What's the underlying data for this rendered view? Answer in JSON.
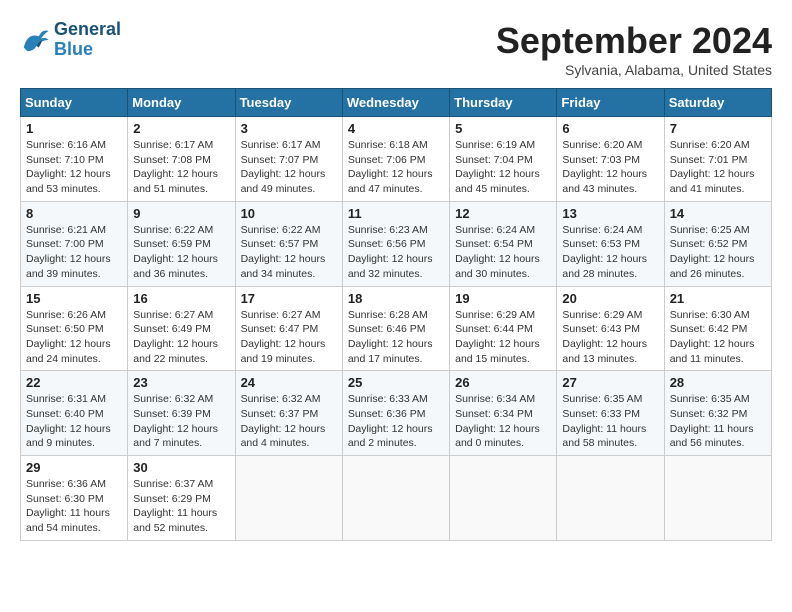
{
  "header": {
    "logo_line1": "General",
    "logo_line2": "Blue",
    "month": "September 2024",
    "location": "Sylvania, Alabama, United States"
  },
  "weekdays": [
    "Sunday",
    "Monday",
    "Tuesday",
    "Wednesday",
    "Thursday",
    "Friday",
    "Saturday"
  ],
  "weeks": [
    [
      {
        "day": "1",
        "info": "Sunrise: 6:16 AM\nSunset: 7:10 PM\nDaylight: 12 hours\nand 53 minutes."
      },
      {
        "day": "2",
        "info": "Sunrise: 6:17 AM\nSunset: 7:08 PM\nDaylight: 12 hours\nand 51 minutes."
      },
      {
        "day": "3",
        "info": "Sunrise: 6:17 AM\nSunset: 7:07 PM\nDaylight: 12 hours\nand 49 minutes."
      },
      {
        "day": "4",
        "info": "Sunrise: 6:18 AM\nSunset: 7:06 PM\nDaylight: 12 hours\nand 47 minutes."
      },
      {
        "day": "5",
        "info": "Sunrise: 6:19 AM\nSunset: 7:04 PM\nDaylight: 12 hours\nand 45 minutes."
      },
      {
        "day": "6",
        "info": "Sunrise: 6:20 AM\nSunset: 7:03 PM\nDaylight: 12 hours\nand 43 minutes."
      },
      {
        "day": "7",
        "info": "Sunrise: 6:20 AM\nSunset: 7:01 PM\nDaylight: 12 hours\nand 41 minutes."
      }
    ],
    [
      {
        "day": "8",
        "info": "Sunrise: 6:21 AM\nSunset: 7:00 PM\nDaylight: 12 hours\nand 39 minutes."
      },
      {
        "day": "9",
        "info": "Sunrise: 6:22 AM\nSunset: 6:59 PM\nDaylight: 12 hours\nand 36 minutes."
      },
      {
        "day": "10",
        "info": "Sunrise: 6:22 AM\nSunset: 6:57 PM\nDaylight: 12 hours\nand 34 minutes."
      },
      {
        "day": "11",
        "info": "Sunrise: 6:23 AM\nSunset: 6:56 PM\nDaylight: 12 hours\nand 32 minutes."
      },
      {
        "day": "12",
        "info": "Sunrise: 6:24 AM\nSunset: 6:54 PM\nDaylight: 12 hours\nand 30 minutes."
      },
      {
        "day": "13",
        "info": "Sunrise: 6:24 AM\nSunset: 6:53 PM\nDaylight: 12 hours\nand 28 minutes."
      },
      {
        "day": "14",
        "info": "Sunrise: 6:25 AM\nSunset: 6:52 PM\nDaylight: 12 hours\nand 26 minutes."
      }
    ],
    [
      {
        "day": "15",
        "info": "Sunrise: 6:26 AM\nSunset: 6:50 PM\nDaylight: 12 hours\nand 24 minutes."
      },
      {
        "day": "16",
        "info": "Sunrise: 6:27 AM\nSunset: 6:49 PM\nDaylight: 12 hours\nand 22 minutes."
      },
      {
        "day": "17",
        "info": "Sunrise: 6:27 AM\nSunset: 6:47 PM\nDaylight: 12 hours\nand 19 minutes."
      },
      {
        "day": "18",
        "info": "Sunrise: 6:28 AM\nSunset: 6:46 PM\nDaylight: 12 hours\nand 17 minutes."
      },
      {
        "day": "19",
        "info": "Sunrise: 6:29 AM\nSunset: 6:44 PM\nDaylight: 12 hours\nand 15 minutes."
      },
      {
        "day": "20",
        "info": "Sunrise: 6:29 AM\nSunset: 6:43 PM\nDaylight: 12 hours\nand 13 minutes."
      },
      {
        "day": "21",
        "info": "Sunrise: 6:30 AM\nSunset: 6:42 PM\nDaylight: 12 hours\nand 11 minutes."
      }
    ],
    [
      {
        "day": "22",
        "info": "Sunrise: 6:31 AM\nSunset: 6:40 PM\nDaylight: 12 hours\nand 9 minutes."
      },
      {
        "day": "23",
        "info": "Sunrise: 6:32 AM\nSunset: 6:39 PM\nDaylight: 12 hours\nand 7 minutes."
      },
      {
        "day": "24",
        "info": "Sunrise: 6:32 AM\nSunset: 6:37 PM\nDaylight: 12 hours\nand 4 minutes."
      },
      {
        "day": "25",
        "info": "Sunrise: 6:33 AM\nSunset: 6:36 PM\nDaylight: 12 hours\nand 2 minutes."
      },
      {
        "day": "26",
        "info": "Sunrise: 6:34 AM\nSunset: 6:34 PM\nDaylight: 12 hours\nand 0 minutes."
      },
      {
        "day": "27",
        "info": "Sunrise: 6:35 AM\nSunset: 6:33 PM\nDaylight: 11 hours\nand 58 minutes."
      },
      {
        "day": "28",
        "info": "Sunrise: 6:35 AM\nSunset: 6:32 PM\nDaylight: 11 hours\nand 56 minutes."
      }
    ],
    [
      {
        "day": "29",
        "info": "Sunrise: 6:36 AM\nSunset: 6:30 PM\nDaylight: 11 hours\nand 54 minutes."
      },
      {
        "day": "30",
        "info": "Sunrise: 6:37 AM\nSunset: 6:29 PM\nDaylight: 11 hours\nand 52 minutes."
      },
      {
        "day": "",
        "info": ""
      },
      {
        "day": "",
        "info": ""
      },
      {
        "day": "",
        "info": ""
      },
      {
        "day": "",
        "info": ""
      },
      {
        "day": "",
        "info": ""
      }
    ]
  ]
}
